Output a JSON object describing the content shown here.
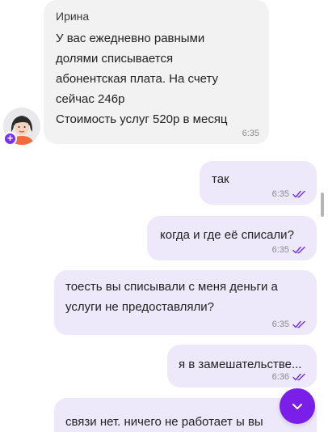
{
  "colors": {
    "incoming_bubble": "#f2f2f3",
    "outgoing_bubble": "#eee8fb",
    "accent": "#7a1fe8",
    "read_ticks": "#6b2ee8"
  },
  "messages": [
    {
      "direction": "incoming",
      "author": "Ирина",
      "text": "У вас ежедневно равными\nдолями списывается\nабонентская плата. На счету\nсейчас 246р\nСтоимость услуг 520р в месяц",
      "time": "6:35"
    },
    {
      "direction": "outgoing",
      "text": "так",
      "time": "6:35",
      "status": "read"
    },
    {
      "direction": "outgoing",
      "text": "когда и где её списали?",
      "time": "6:35",
      "status": "read"
    },
    {
      "direction": "outgoing",
      "text": "тоесть вы списывали с меня деньги а\nуслуги не предоставляли?",
      "time": "6:35",
      "status": "read"
    },
    {
      "direction": "outgoing",
      "text": "я в замешательстве...",
      "time": "6:36",
      "status": "read"
    },
    {
      "direction": "outgoing",
      "text": "связи нет. ничего не работает ы вы",
      "time": "",
      "status": ""
    }
  ],
  "icons": {
    "avatar": "operator-avatar",
    "avatar_badge": "plus-icon",
    "read_status": "double-check-icon",
    "scroll_down": "chevron-down-icon"
  }
}
